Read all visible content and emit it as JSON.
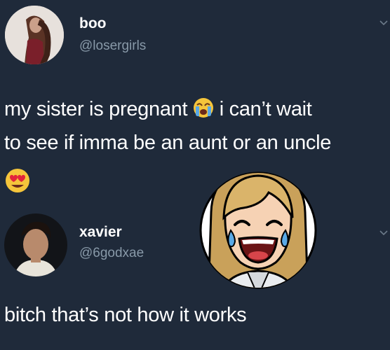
{
  "tweet1": {
    "name": "boo",
    "handle": "@losergirls",
    "text_line1_a": "my sister is pregnant ",
    "text_line1_b": " i can’t wait",
    "text_line2": "to see if imma be an aunt or an uncle",
    "emoji_1": "crying-face",
    "emoji_2": "heart-eyes-face"
  },
  "reply": {
    "name": "xavier",
    "handle": "@6godxae",
    "text": "bitch that’s not how it works"
  },
  "overlay": {
    "sticker": "laughing-crying-bitmoji"
  },
  "colors": {
    "background": "#1f2a3a",
    "handle": "#8899a8",
    "text": "#ffffff"
  }
}
